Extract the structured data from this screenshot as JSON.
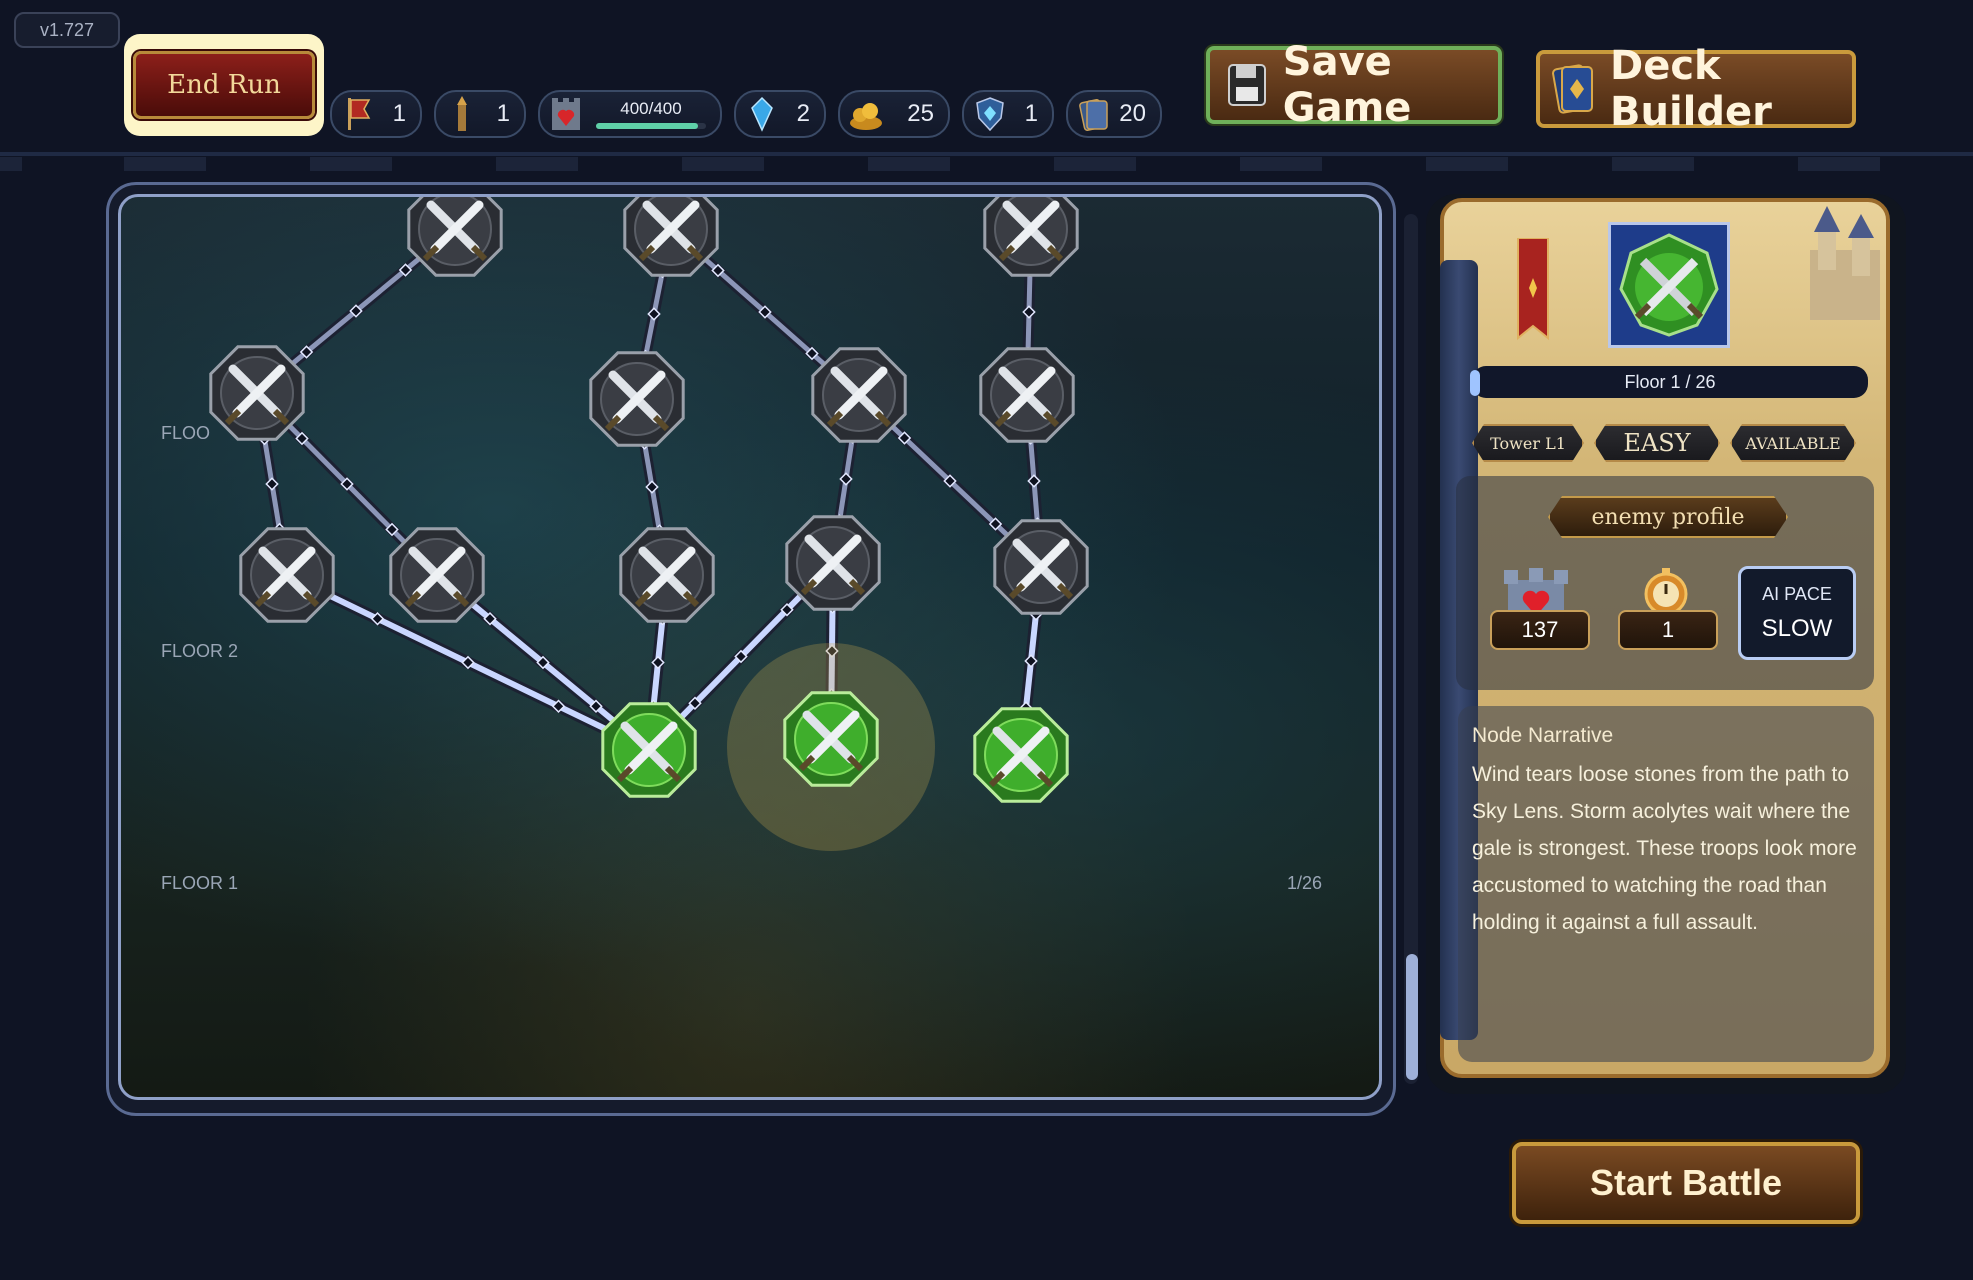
{
  "app": {
    "version": "v1.727"
  },
  "header": {
    "end_run_label": "End Run",
    "save_game_label": "Save Game",
    "deck_builder_label": "Deck Builder",
    "resources": [
      {
        "icon": "banner-icon",
        "value": "1"
      },
      {
        "icon": "tower-icon",
        "value": "1"
      },
      {
        "icon": "castle-heart-icon",
        "value": "400/400",
        "progress": 0.93
      },
      {
        "icon": "crystal-icon",
        "value": "2"
      },
      {
        "icon": "gold-pile-icon",
        "value": "25"
      },
      {
        "icon": "shield-gem-icon",
        "value": "1"
      },
      {
        "icon": "card-deck-icon",
        "value": "20"
      }
    ]
  },
  "map": {
    "floor_labels": [
      "FLOOR 2",
      "FLOOR 1"
    ],
    "side_labels": [
      "1/26"
    ],
    "node_states": {
      "available": "#3fae2c",
      "locked": "#3a3d44"
    }
  },
  "panel": {
    "floor_text": "Floor 1 / 26",
    "tower_label": "Tower L1",
    "difficulty": "EASY",
    "status": "AVAILABLE",
    "enemy_profile_label": "enemy profile",
    "enemy_hp": "137",
    "enemy_timer": "1",
    "ai_pace_label": "AI PACE",
    "ai_pace_value": "SLOW",
    "narrative_title": "Node Narrative",
    "narrative_text": "Wind tears loose stones from the path to Sky Lens. Storm acolytes wait where the gale is strongest. These troops look more accustomed to watching the road than holding it against a full assault."
  },
  "footer": {
    "start_battle_label": "Start Battle"
  },
  "colors": {
    "accent_green": "#3fae2c",
    "frame_blue": "#8fa0c8",
    "wood": "#6a3f1e",
    "gold_border": "#c99a3c"
  }
}
